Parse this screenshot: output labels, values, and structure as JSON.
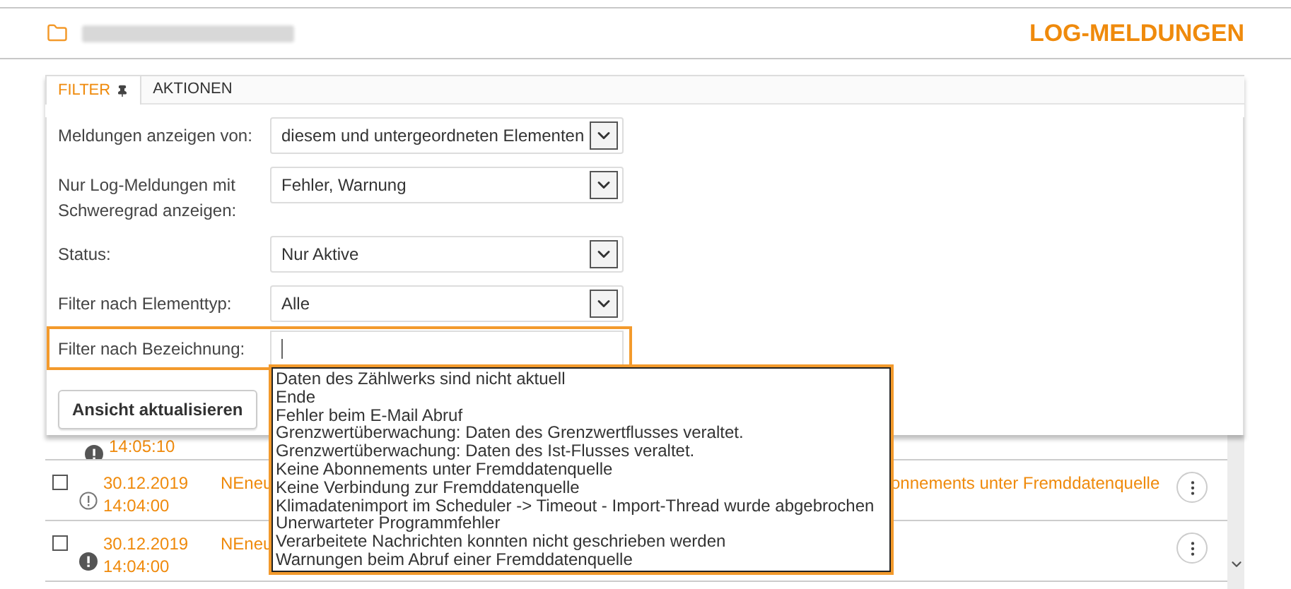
{
  "header": {
    "title": "LOG-MELDUNGEN"
  },
  "tabs": [
    {
      "label": "FILTER",
      "selected": true,
      "pinned": true
    },
    {
      "label": "AKTIONEN",
      "selected": false,
      "pinned": false
    }
  ],
  "filters": [
    {
      "kind": "select",
      "label": "Meldungen anzeigen von:",
      "value": "diesem und untergeordneten Elementen",
      "focused": false
    },
    {
      "kind": "select",
      "label": "Nur Log-Meldungen mit Schweregrad anzeigen:",
      "value": "Fehler, Warnung",
      "focused": false
    },
    {
      "kind": "select",
      "label": "Status:",
      "value": "Nur Aktive",
      "focused": false
    },
    {
      "kind": "select",
      "label": "Filter nach Elementtyp:",
      "value": "Alle",
      "focused": false
    },
    {
      "kind": "text",
      "label": "Filter nach Bezeichnung:",
      "focused": true
    }
  ],
  "update_button": "Ansicht aktualisieren",
  "suggestions": [
    "Daten des Zählwerks sind nicht aktuell",
    "Ende",
    "Fehler beim E-Mail Abruf",
    "Grenzwertüberwachung: Daten des Grenzwertflusses veraltet.",
    "Grenzwertüberwachung: Daten des Ist-Flusses veraltet.",
    "Keine Abonnements unter Fremddatenquelle",
    "Keine Verbindung zur Fremddatenquelle",
    "Klimadatenimport im Scheduler -> Timeout - Import-Thread wurde abgebrochen",
    "Unerwarteter Programmfehler",
    "Verarbeitete Nachrichten konnten nicht geschrieben werden",
    "Warnungen beim Abruf einer Fremddatenquelle"
  ],
  "log_partial_row": {
    "time": "14:05:10",
    "kind": "error"
  },
  "log_rows": [
    {
      "checked": false,
      "kind": "warning",
      "date": "30.12.2019",
      "time": "14:04:00",
      "name": "NEneu",
      "message": "onnements unter Fremddatenquelle"
    },
    {
      "checked": false,
      "kind": "error",
      "date": "30.12.2019",
      "time": "14:04:00",
      "name": "NEneu"
    }
  ]
}
